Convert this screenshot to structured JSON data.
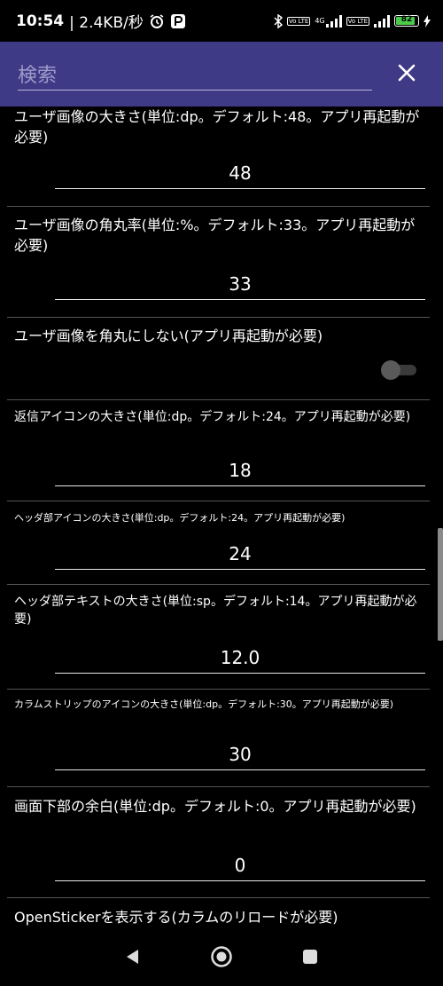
{
  "status": {
    "time": "10:54",
    "network_speed": "| 2.4KB/秒",
    "net1": "Vo LTE",
    "net2": "4G",
    "net3": "Vo LTE",
    "battery": "82"
  },
  "appbar": {
    "search_placeholder": "検索",
    "close_icon": "close-icon"
  },
  "settings": [
    {
      "label": "ユーザ画像の大きさ(単位:dp。デフォルト:48。アプリ再起動が必要)",
      "value": "48"
    },
    {
      "label": "ユーザ画像の角丸率(単位:%。デフォルト:33。アプリ再起動が必要)",
      "value": "33"
    },
    {
      "label": "ユーザ画像を角丸にしない(アプリ再起動が必要)"
    },
    {
      "label": "返信アイコンの大きさ(単位:dp。デフォルト:24。アプリ再起動が必要)",
      "value": "18"
    },
    {
      "label": "ヘッダ部アイコンの大きさ(単位:dp。デフォルト:24。アプリ再起動が必要)",
      "value": "24"
    },
    {
      "label": "ヘッダ部テキストの大きさ(単位:sp。デフォルト:14。アプリ再起動が必要)",
      "value": "12.0"
    },
    {
      "label": "カラムストリップのアイコンの大きさ(単位:dp。デフォルト:30。アプリ再起動が必要)",
      "value": "30"
    },
    {
      "label": "画面下部の余白(単位:dp。デフォルト:0。アプリ再起動が必要)",
      "value": "0"
    },
    {
      "label": "OpenStickerを表示する(カラムのリロードが必要)"
    }
  ],
  "toggle_state": false,
  "nav": {
    "back_icon": "back-icon",
    "home_icon": "home-icon",
    "recents_icon": "recents-icon"
  }
}
